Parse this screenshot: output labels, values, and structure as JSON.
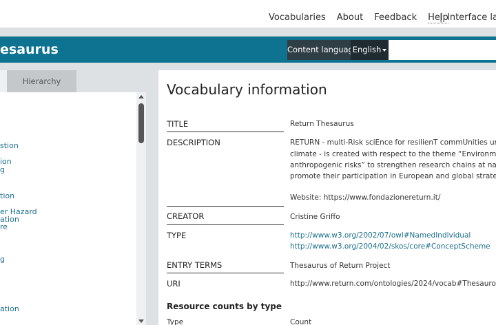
{
  "topnav": {
    "links": [
      "Vocabularies",
      "About",
      "Feedback",
      "Help"
    ],
    "separator": "|",
    "interface_language": "Interface lang"
  },
  "header": {
    "title": "esaurus",
    "content_language_label": "Content language",
    "language_selected": "English",
    "search_placeholder": ""
  },
  "sidebar": {
    "tabs": {
      "hierarchy": "Hierarchy"
    },
    "items": [
      "stion",
      "ion",
      "g",
      "tion",
      "er Hazard",
      "ation",
      "re",
      "g",
      "ation"
    ]
  },
  "main": {
    "heading": "Vocabulary information",
    "title_label": "TITLE",
    "title_value": "Return Thesaurus",
    "description_label": "DESCRIPTION",
    "description_lines": [
      "RETURN - multi-Risk sciEnce for resilienT commUnities undeR",
      "climate - is created with respect to the theme “Environmental",
      "anthropogenic risks” to strengthen research chains at nationa",
      "promote their participation in European and global strategic v"
    ],
    "description_website": "Website: https://www.fondazionereturn.it/",
    "creator_label": "CREATOR",
    "creator_value": "Cristine Griffo",
    "type_label": "TYPE",
    "type_values": [
      "http://www.w3.org/2002/07/owl#NamedIndividual",
      "http://www.w3.org/2004/02/skos/core#ConceptScheme"
    ],
    "entry_terms_label": "ENTRY TERMS",
    "entry_terms_value": "Thesaurus of Return Project",
    "uri_label": "URI",
    "uri_value": "http://www.return.com/ontologies/2024/vocab#Thesauro",
    "resource_counts_heading": "Resource counts by type",
    "counts_columns": [
      "Type",
      "Count"
    ]
  },
  "colors": {
    "header_band": "#0d7390",
    "link": "#1b6f8c",
    "language_dark": "#1f2b31"
  }
}
